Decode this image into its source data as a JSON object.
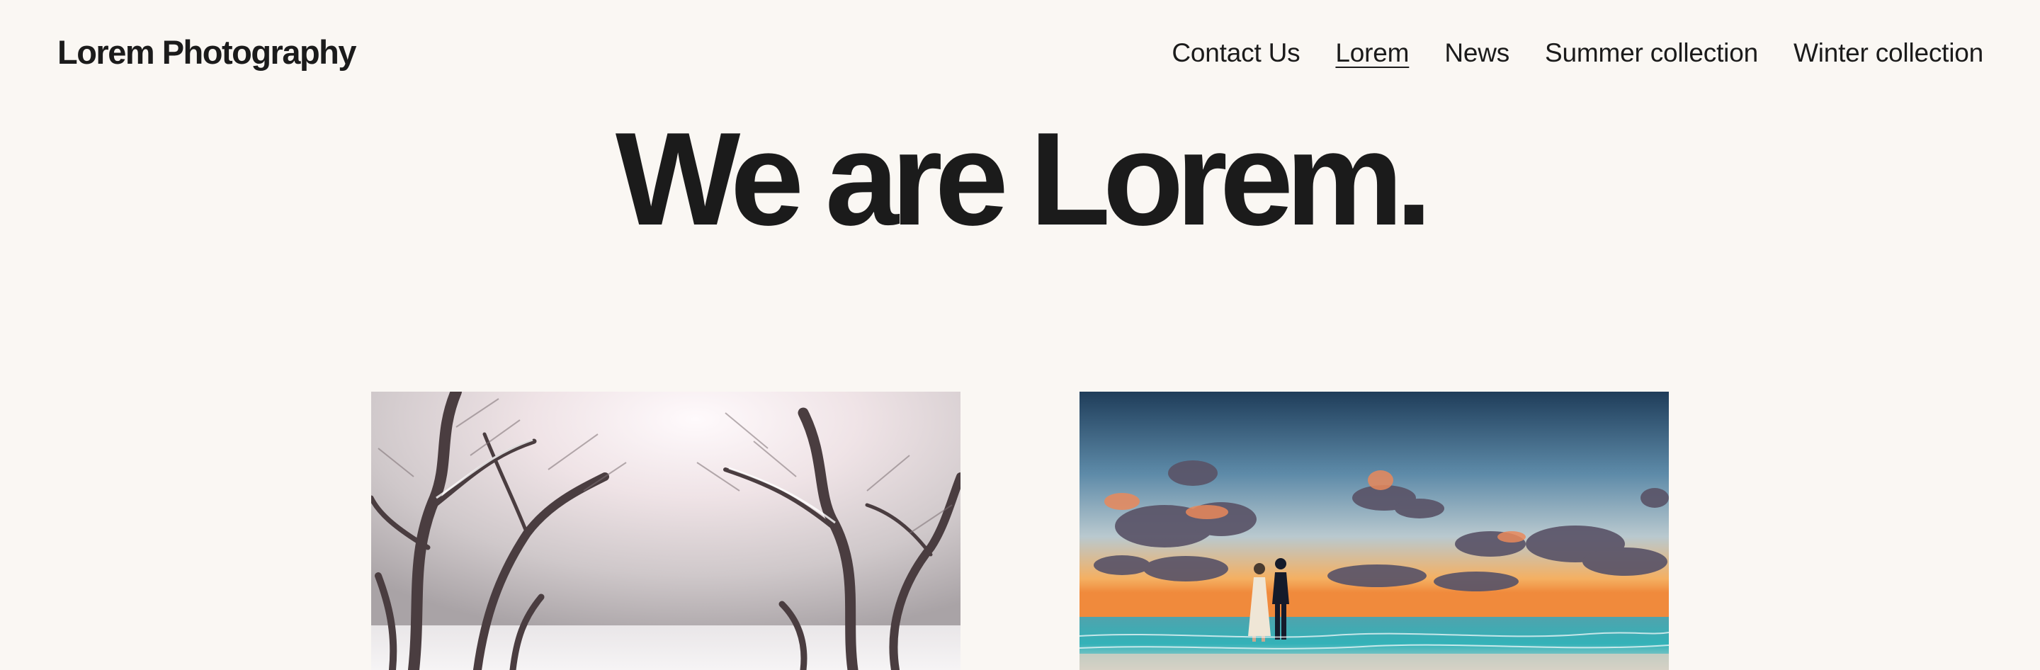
{
  "site": {
    "title": "Lorem Photography"
  },
  "nav": {
    "items": [
      {
        "label": "Contact Us",
        "current": false
      },
      {
        "label": "Lorem",
        "current": true
      },
      {
        "label": "News",
        "current": false
      },
      {
        "label": "Summer collection",
        "current": false
      },
      {
        "label": "Winter collection",
        "current": false
      }
    ]
  },
  "hero": {
    "title": "We are Lorem."
  },
  "colors": {
    "background": "#faf7f3",
    "text": "#1b1b1b"
  },
  "gallery": {
    "images": [
      {
        "subject": "snowy tree-lined path in winter"
      },
      {
        "subject": "couple walking on beach at sunset"
      }
    ]
  }
}
